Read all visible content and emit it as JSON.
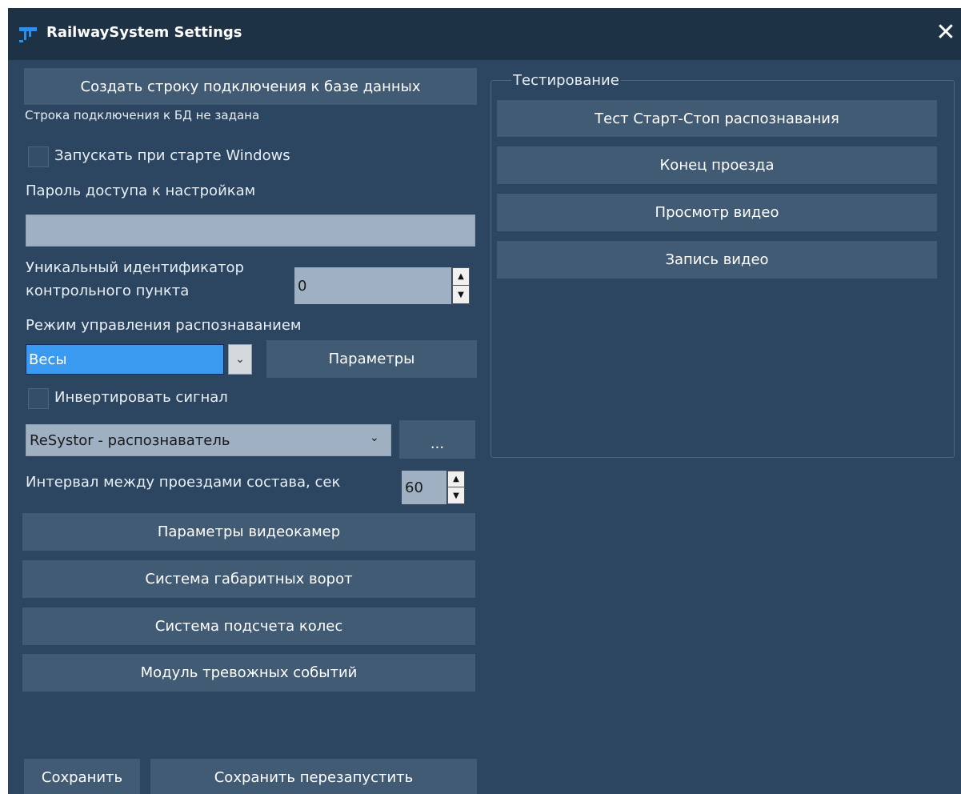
{
  "window": {
    "title": "RailwaySystem Settings",
    "accent": "#3a9af0",
    "background": "#2c4661"
  },
  "left": {
    "create_connection_button": "Создать строку подключения к базе данных",
    "connection_status": "Строка подключения к БД не задана",
    "autostart_label": "Запускать при старте Windows",
    "password_label": "Пароль доступа к настройкам",
    "password_value": "",
    "checkpoint_id_label_line1": "Уникальный идентификатор",
    "checkpoint_id_label_line2": "контрольного пункта",
    "checkpoint_id_value": "0",
    "mode_label": "Режим управления распознаванием",
    "mode_value": "Весы",
    "params_button": "Параметры",
    "invert_label": "Инвертировать сигнал",
    "recognizer_value": "ReSystor - распознаватель",
    "recognizer_more_button": "...",
    "interval_label": "Интервал между проездами состава, сек",
    "interval_value": "60",
    "cameras_button": "Параметры видеокамер",
    "gates_button": "Система габаритных ворот",
    "wheels_button": "Система подсчета колес",
    "alarms_button": "Модуль тревожных событий",
    "save_button": "Сохранить",
    "save_restart_button": "Сохранить перезапустить"
  },
  "testing": {
    "title": "Тестирование",
    "buttons": [
      "Тест Старт-Стоп распознавания",
      "Конец проезда",
      "Просмотр видео",
      "Запись видео"
    ]
  }
}
